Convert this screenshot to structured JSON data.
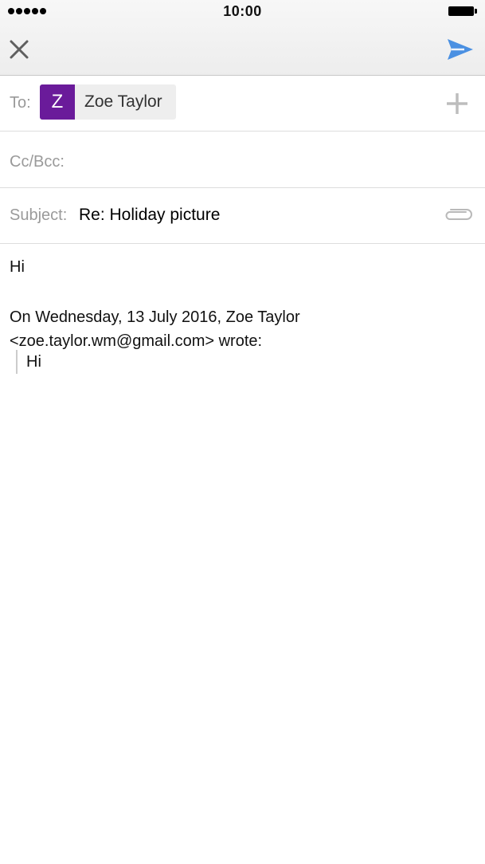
{
  "status_bar": {
    "time": "10:00"
  },
  "compose": {
    "to_label": "To:",
    "recipient": {
      "initial": "Z",
      "name": "Zoe Taylor",
      "avatar_color": "#6a1b9a"
    },
    "cc_label": "Cc/Bcc:",
    "subject_label": "Subject:",
    "subject": "Re: Holiday picture"
  },
  "body": {
    "greeting": "Hi",
    "attribution_line1": "On Wednesday, 13 July 2016, Zoe Taylor",
    "attribution_line2": "<zoe.taylor.wm@gmail.com> wrote:",
    "quoted": "Hi"
  },
  "icons": {
    "close": "close-icon",
    "send": "send-icon",
    "add": "plus-icon",
    "attach": "paperclip-icon"
  },
  "colors": {
    "accent": "#4a90e2",
    "avatar": "#6a1b9a"
  }
}
